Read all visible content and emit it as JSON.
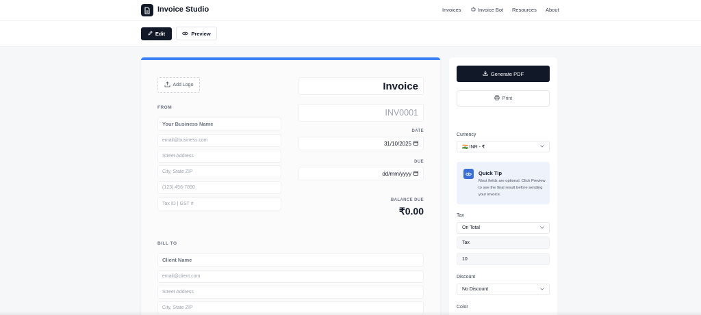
{
  "app": {
    "brand": "Invoice Studio"
  },
  "nav": {
    "links": [
      "Invoices",
      "Invoice Bot",
      "Resources",
      "About"
    ]
  },
  "toolbar": {
    "edit_label": "Edit",
    "preview_label": "Preview"
  },
  "invoice": {
    "add_logo_label": "Add Logo",
    "from_label": "FROM",
    "from_fields": {
      "business_name": "Your Business Name",
      "email": "email@business.com",
      "street": "Street Address",
      "city": "City, State ZIP",
      "phone": "(123) 456-7890",
      "tax_id": "Tax ID | GST #"
    },
    "title": "Invoice",
    "number_placeholder": "INV0001",
    "date_label": "DATE",
    "date_value": "31/10/2025",
    "due_label": "DUE",
    "due_placeholder": "dd/mm/yyyy",
    "balance_label": "BALANCE DUE",
    "balance_value": "₹0.00",
    "bill_to_label": "BILL TO",
    "bill_to_fields": {
      "client_name": "Client Name",
      "email": "email@client.com",
      "street": "Street Address",
      "city": "City, State ZIP"
    }
  },
  "sidebar": {
    "generate_pdf_label": "Generate PDF",
    "print_label": "Print",
    "currency_label": "Currency",
    "currency_value": "🇮🇳 INR - ₹",
    "tip": {
      "title": "Quick Tip",
      "body": "Most fields are optional. Click Preview to see the final result before sending your invoice."
    },
    "tax_label": "Tax",
    "tax_mode": "On Total",
    "tax_name": "Tax",
    "tax_value": "10",
    "discount_label": "Discount",
    "discount_mode": "No Discount",
    "color_label": "Color"
  },
  "colors": {
    "primary_dark": "#111827",
    "accent_blue": "#3b82f6",
    "tip_bg": "#eef2fb",
    "tip_icon": "#3b6fd8"
  },
  "icons": {
    "logo": "document-icon",
    "edit": "pencil-icon",
    "preview": "eye-icon",
    "bot": "bot-icon",
    "upload": "upload-icon",
    "calendar": "calendar-icon",
    "download": "download-icon",
    "print": "printer-icon",
    "tip": "eye-icon",
    "select": "chevron-down-icon"
  }
}
